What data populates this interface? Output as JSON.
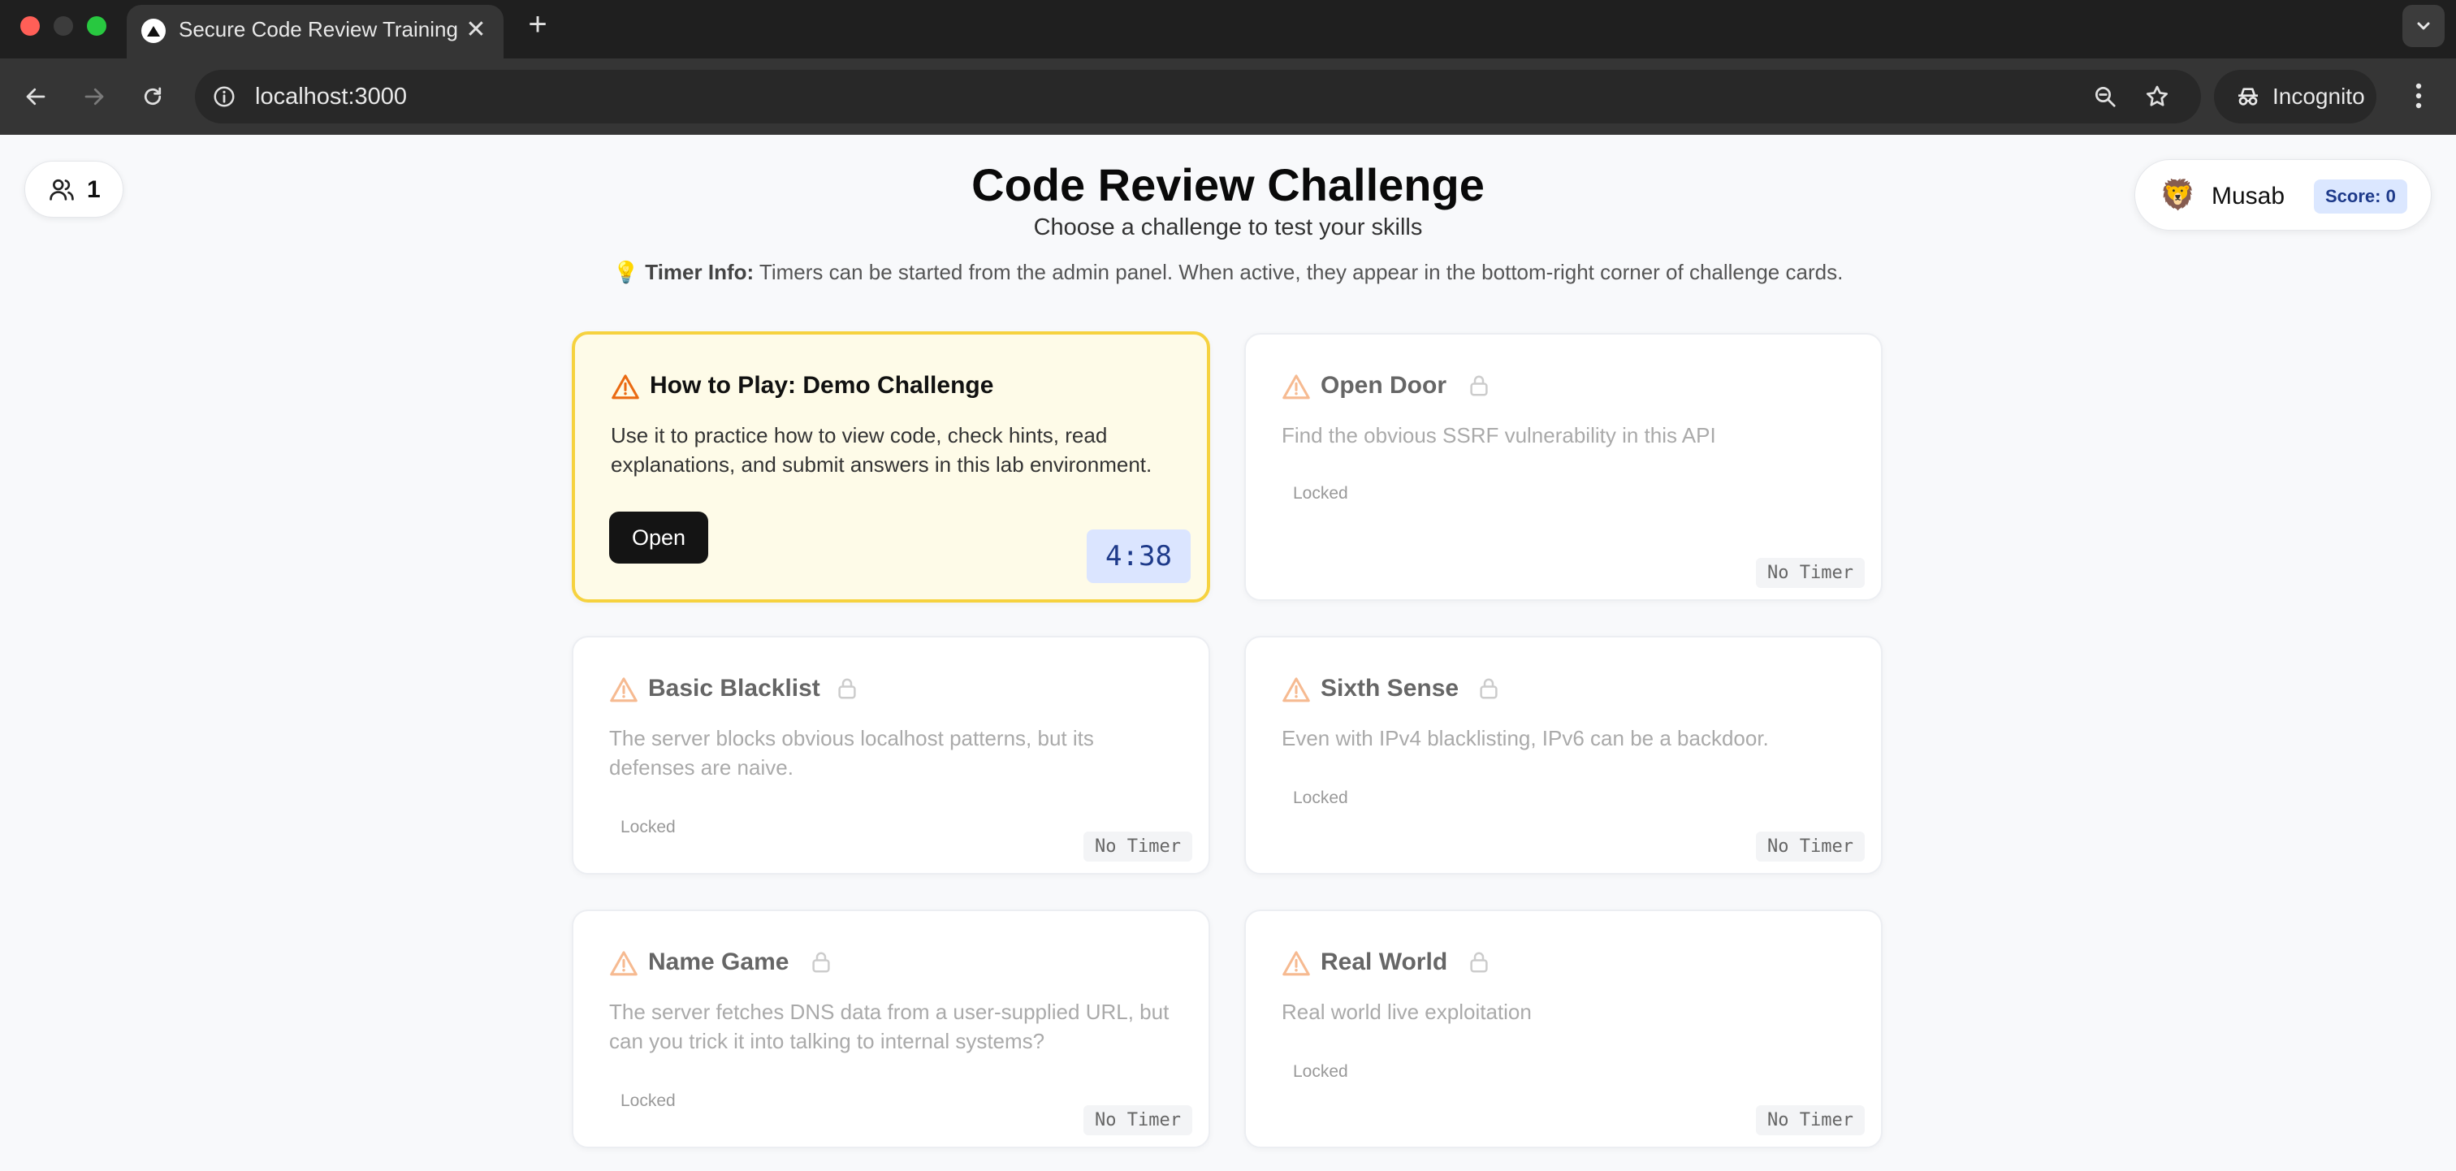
{
  "browser": {
    "tab_title": "Secure Code Review Training",
    "url": "localhost:3000",
    "incognito_label": "Incognito",
    "new_tab_symbol": "+",
    "close_symbol": "✕"
  },
  "players": {
    "count": "1",
    "icon": "users-icon"
  },
  "header": {
    "title": "Code Review Challenge",
    "subtitle": "Choose a challenge to test your skills",
    "timer_info_emoji": "💡",
    "timer_info_label": "Timer Info:",
    "timer_info_text": " Timers can be started from the admin panel. When active, they appear in the bottom-right corner of challenge cards."
  },
  "user": {
    "avatar": "🦁",
    "name": "Musab",
    "score": "Score: 0"
  },
  "colors": {
    "warning_orange": "#ea6a12",
    "active_card_bg": "#fefbe8",
    "active_card_border": "#f6d23f",
    "score_badge_bg": "#dbe7ff",
    "timer_badge_bg": "#dbe5ff"
  },
  "challenges": [
    {
      "title": "How to Play: Demo Challenge",
      "description": "Use it to practice how to view code, check hints, read explanations, and submit answers in this lab environment.",
      "state": "open",
      "button_label": "Open",
      "timer": "4:38"
    },
    {
      "title": "Open Door",
      "description": "Find the obvious SSRF vulnerability in this API",
      "state": "locked",
      "status_label": "Locked",
      "timer": "No Timer"
    },
    {
      "title": "Basic Blacklist",
      "description": "The server blocks obvious localhost patterns, but its defenses are naive.",
      "state": "locked",
      "status_label": "Locked",
      "timer": "No Timer"
    },
    {
      "title": "Sixth Sense",
      "description": "Even with IPv4 blacklisting, IPv6 can be a backdoor.",
      "state": "locked",
      "status_label": "Locked",
      "timer": "No Timer"
    },
    {
      "title": "Name Game",
      "description": "The server fetches DNS data from a user-supplied URL, but can you trick it into talking to internal systems?",
      "state": "locked",
      "status_label": "Locked",
      "timer": "No Timer"
    },
    {
      "title": "Real World",
      "description": "Real world live exploitation",
      "state": "locked",
      "status_label": "Locked",
      "timer": "No Timer"
    }
  ]
}
